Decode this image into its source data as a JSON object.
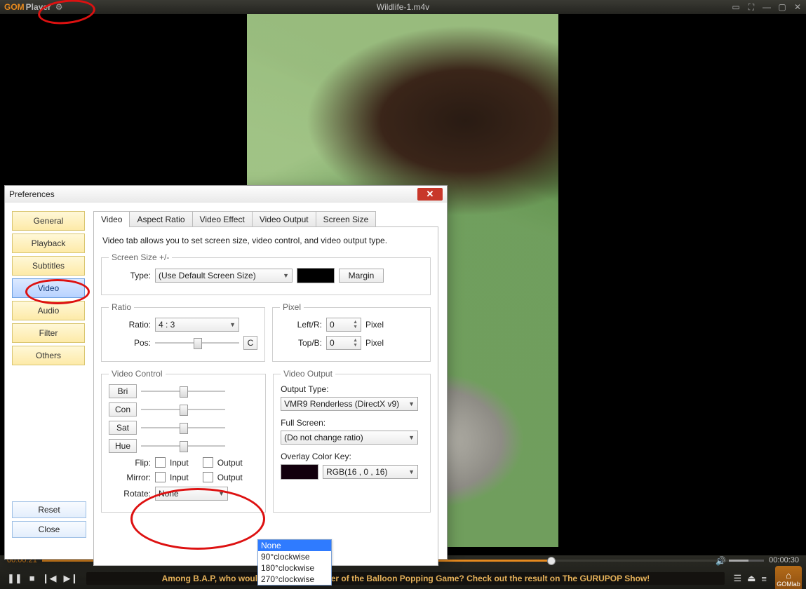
{
  "app": {
    "brand_a": "GOM",
    "brand_b": "Player",
    "file_title": "Wildlife-1.m4v"
  },
  "player": {
    "time_current": "00:00:21",
    "time_total": "00:00:30",
    "news_text": "Among B.A.P, who would be the final winner of the Balloon Popping Game? Check out the result on The GURUPOP Show!",
    "home_label": "GOMlab"
  },
  "prefs": {
    "title": "Preferences",
    "categories": [
      "General",
      "Playback",
      "Subtitles",
      "Video",
      "Audio",
      "Filter",
      "Others"
    ],
    "category_active": "Video",
    "reset_label": "Reset",
    "close_label": "Close",
    "tabs": [
      "Video",
      "Aspect Ratio",
      "Video Effect",
      "Video Output",
      "Screen Size"
    ],
    "tab_active": "Video",
    "desc": "Video tab allows you to set screen size, video control, and video output type.",
    "screen_size": {
      "legend": "Screen Size +/-",
      "type_label": "Type:",
      "type_value": "(Use Default Screen Size)",
      "margin_label": "Margin"
    },
    "ratio": {
      "legend": "Ratio",
      "ratio_label": "Ratio:",
      "ratio_value": "4 : 3",
      "pos_label": "Pos:",
      "c_label": "C"
    },
    "pixel": {
      "legend": "Pixel",
      "leftr_label": "Left/R:",
      "topb_label": "Top/B:",
      "value": "0",
      "unit": "Pixel"
    },
    "video_control": {
      "legend": "Video Control",
      "bri": "Bri",
      "con": "Con",
      "sat": "Sat",
      "hue": "Hue",
      "flip_label": "Flip:",
      "mirror_label": "Mirror:",
      "rotate_label": "Rotate:",
      "input": "Input",
      "output": "Output",
      "rotate_value": "None",
      "rotate_options": [
        "None",
        "90°clockwise",
        "180°clockwise",
        "270°clockwise"
      ]
    },
    "video_output": {
      "legend": "Video Output",
      "output_type_label": "Output Type:",
      "output_type_value": "VMR9 Renderless (DirectX v9)",
      "fullscreen_label": "Full Screen:",
      "fullscreen_value": "(Do not change ratio)",
      "overlay_label": "Overlay Color Key:",
      "overlay_value": "RGB(16 , 0 , 16)"
    }
  }
}
